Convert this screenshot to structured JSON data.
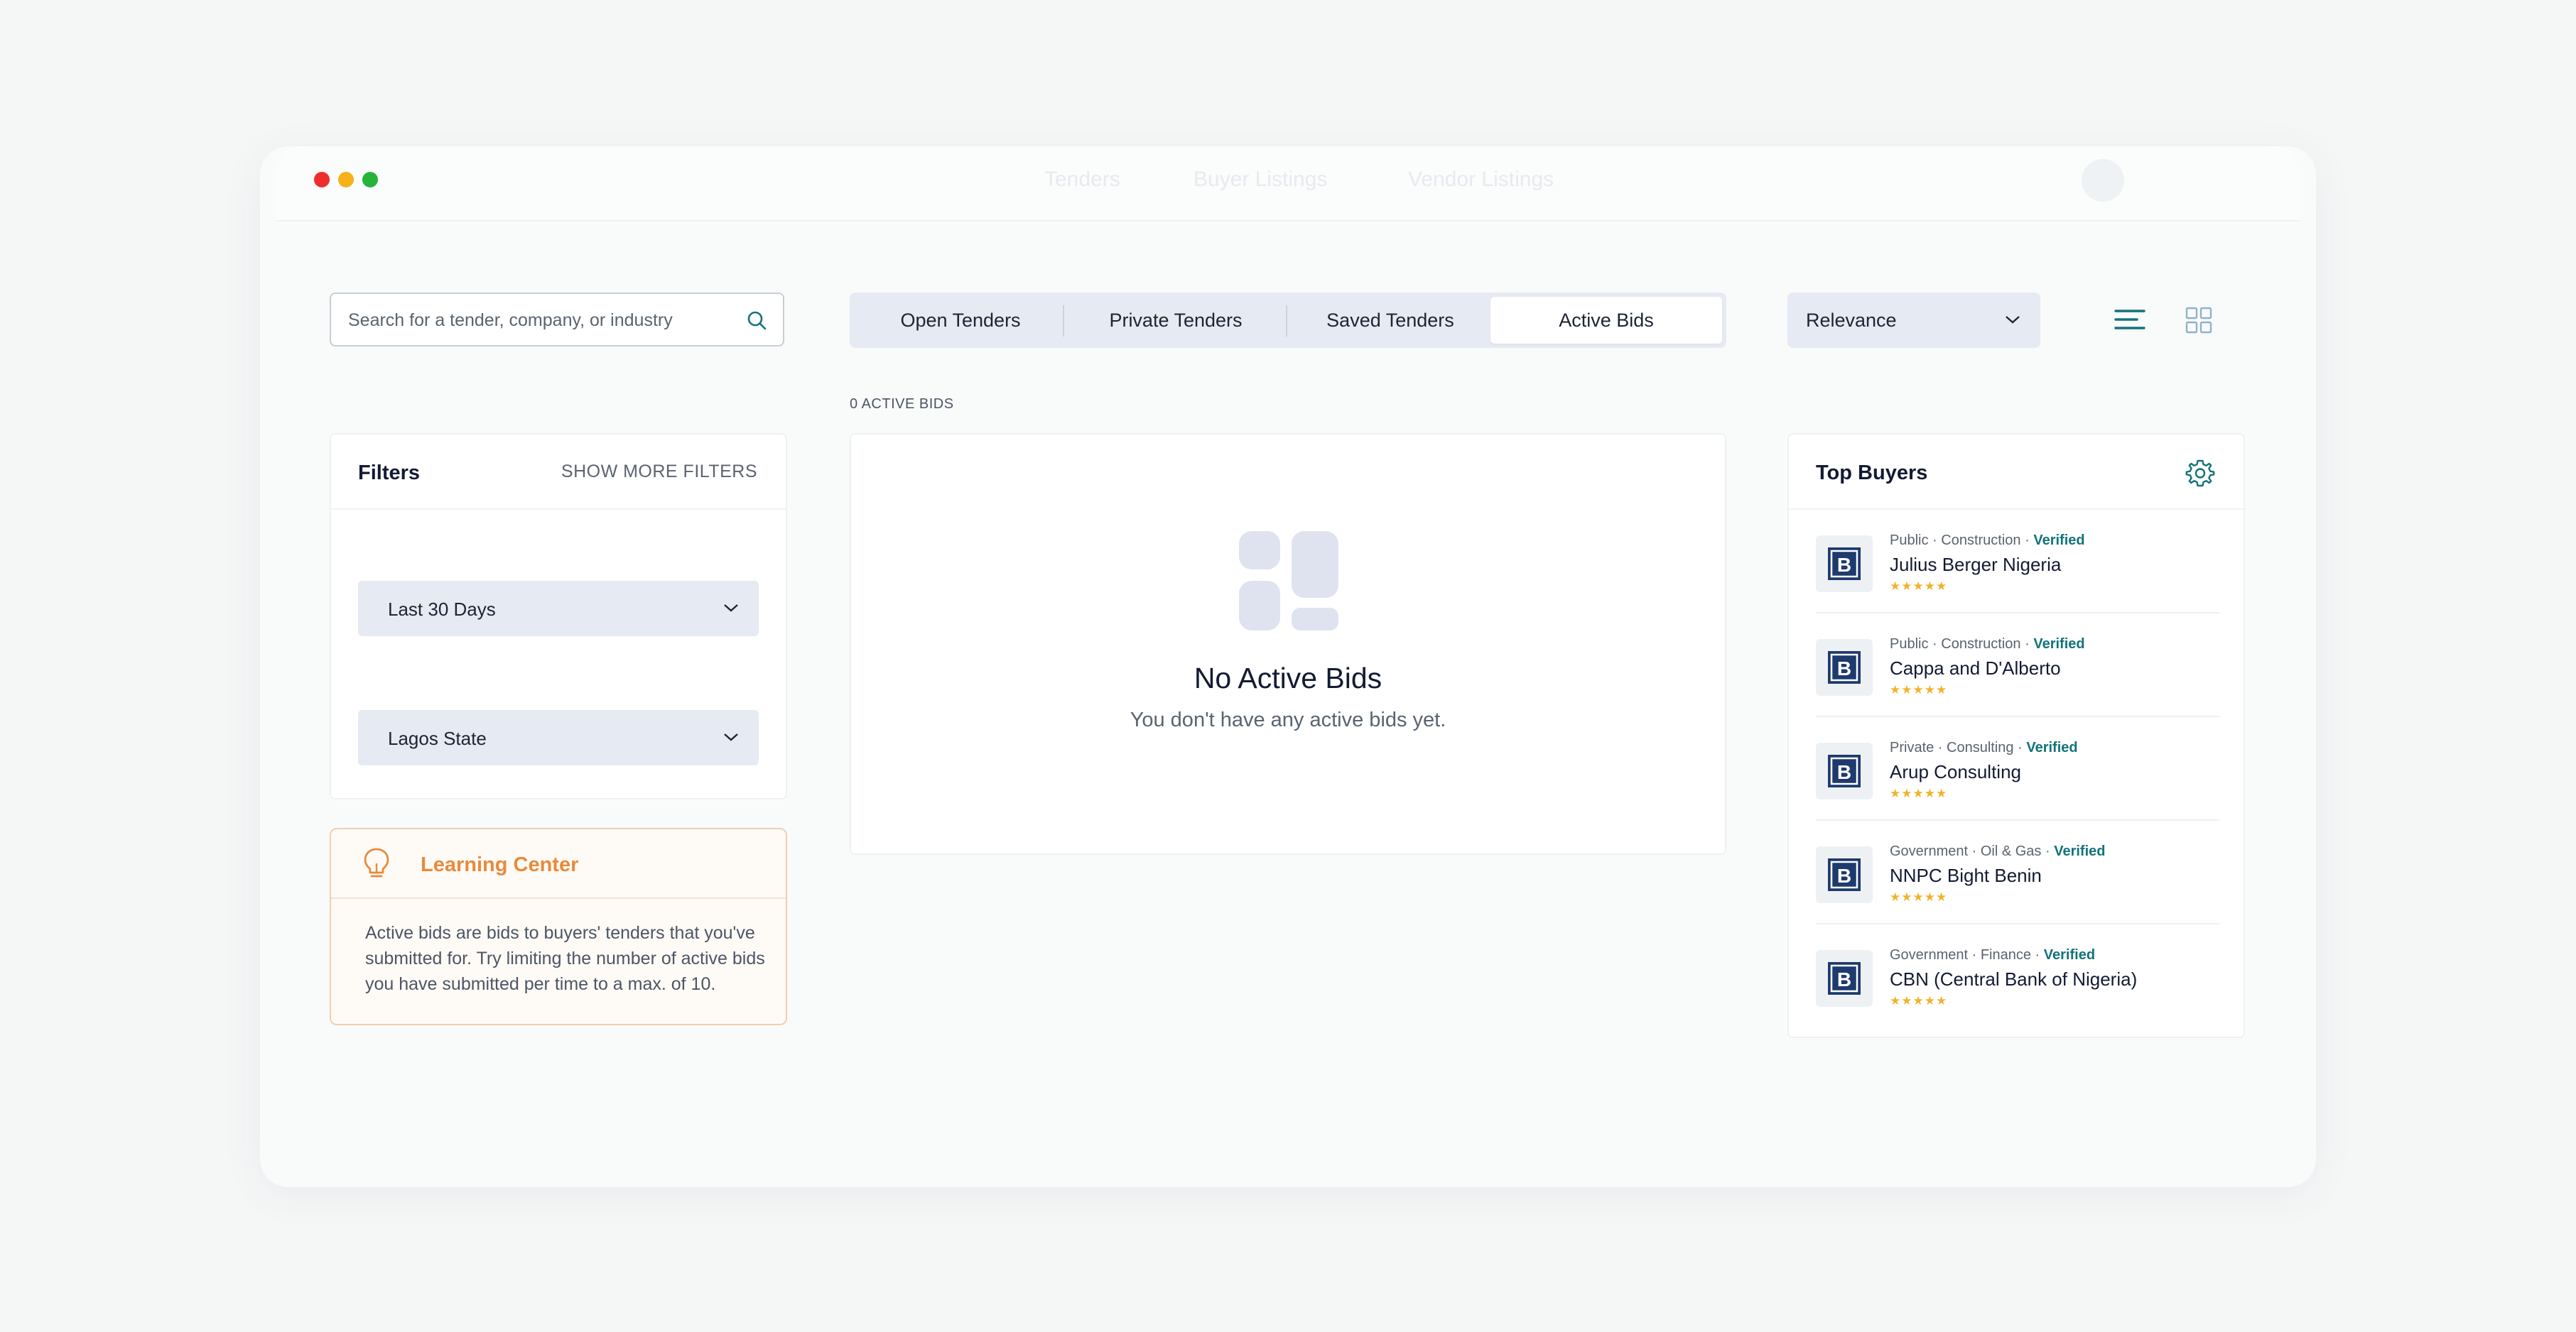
{
  "window": {
    "dots": [
      "#ef2d2d",
      "#f6b21a",
      "#27b33a"
    ],
    "faint_nav": [
      "Tenders",
      "Buyer Listings",
      "Vendor Listings"
    ]
  },
  "search": {
    "placeholder": "Search for a tender, company, or industry",
    "icon": "search-icon"
  },
  "tabs": [
    {
      "label": "Open Tenders",
      "active": false
    },
    {
      "label": "Private Tenders",
      "active": false
    },
    {
      "label": "Saved Tenders",
      "active": false
    },
    {
      "label": "Active Bids",
      "active": true
    }
  ],
  "sort": {
    "selected": "Relevance"
  },
  "view_toggle": {
    "list_icon": "list-view-icon",
    "grid_icon": "grid-view-icon",
    "active": "list"
  },
  "filters": {
    "title": "Filters",
    "show_more": "SHOW MORE FILTERS",
    "date_range": "Last 30 Days",
    "location": "Lagos State"
  },
  "learning_center": {
    "title": "Learning Center",
    "icon": "lightbulb-icon",
    "body": "Active bids are bids to buyers' tenders that you've submitted for. Try limiting the number of active bids you have submitted per time to a max. of 10."
  },
  "results": {
    "count_label": "0 ACTIVE BIDS",
    "empty_title": "No Active Bids",
    "empty_subtitle": "You don't have any active bids yet."
  },
  "top_buyers": {
    "title": "Top Buyers",
    "settings_icon": "gear-icon",
    "items": [
      {
        "type": "Public",
        "industry": "Construction",
        "verified": "Verified",
        "name": "Julius Berger Nigeria",
        "rating": "★★★★★"
      },
      {
        "type": "Public",
        "industry": "Construction",
        "verified": "Verified",
        "name": "Cappa and D'Alberto",
        "rating": "★★★★★"
      },
      {
        "type": "Private",
        "industry": "Consulting",
        "verified": "Verified",
        "name": "Arup Consulting",
        "rating": "★★★★★"
      },
      {
        "type": "Government",
        "industry": "Oil & Gas",
        "verified": "Verified",
        "name": "NNPC Bight Benin",
        "rating": "★★★★★"
      },
      {
        "type": "Government",
        "industry": "Finance",
        "verified": "Verified",
        "name": "CBN (Central Bank of Nigeria)",
        "rating": "★★★★★"
      }
    ]
  },
  "colors": {
    "accent_teal": "#12737a",
    "learning_orange": "#e98a3b",
    "star_gold": "#f1b32b",
    "panel_grey": "#e6eaf2",
    "logo_navy": "#1e3a6e"
  }
}
